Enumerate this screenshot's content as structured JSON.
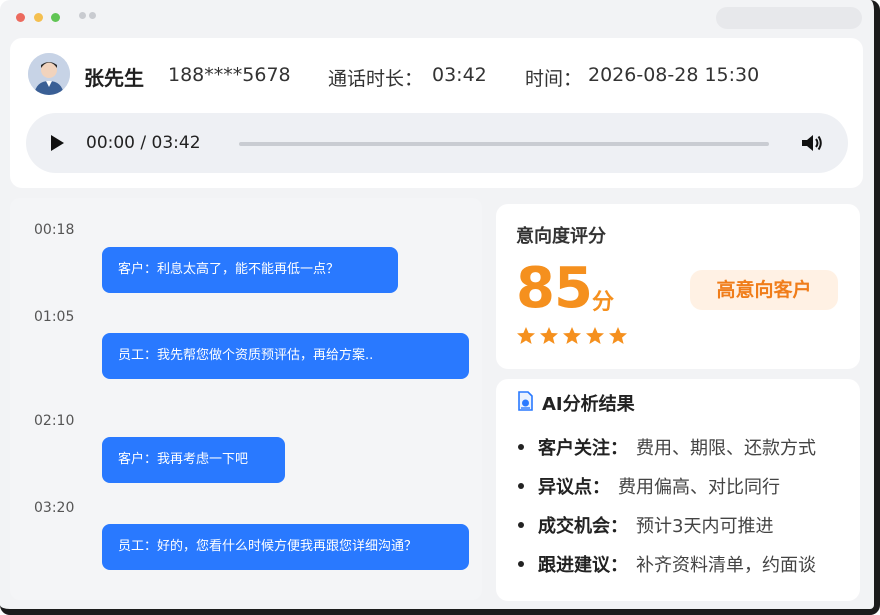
{
  "window": {
    "controls": [
      "close",
      "minimize",
      "maximize"
    ]
  },
  "header": {
    "customer_name": "张先生",
    "phone": "188****5678",
    "duration_label": "通话时长：",
    "duration_value": "03:42",
    "time_label": "时间：",
    "time_value": "2026-08-28 15:30"
  },
  "player": {
    "current_time": "00:00",
    "total_time": "03:42",
    "time_display": "00:00 / 03:42",
    "progress_fraction": 0.0,
    "play_icon": "play-icon",
    "volume_icon": "volume-icon"
  },
  "transcript": [
    {
      "time": "00:18",
      "text": "客户：利息太高了，能不能再低一点？"
    },
    {
      "time": "01:05",
      "text": "员工：我先帮您做个资质预评估，再给方案.."
    },
    {
      "time": "02:10",
      "text": "客户：我再考虑一下吧"
    },
    {
      "time": "03:20",
      "text": "员工：好的，您看什么时候方便我再跟您详细沟通？"
    }
  ],
  "score": {
    "title": "意向度评分",
    "value": "85",
    "unit": "分",
    "badge": "高意向客户",
    "stars": 5,
    "star_color": "#f5901e"
  },
  "ai_analysis": {
    "icon": "ai-document-icon",
    "title": "AI分析结果",
    "items": [
      {
        "key": "客户关注：",
        "value": "费用、期限、还款方式"
      },
      {
        "key": "异议点：",
        "value": "费用偏高、对比同行"
      },
      {
        "key": "成交机会：",
        "value": "预计3天内可推进"
      },
      {
        "key": "跟进建议：",
        "value": "补齐资料清单，约面谈"
      }
    ]
  },
  "colors": {
    "accent_blue": "#2979ff",
    "accent_orange": "#f5901e"
  }
}
